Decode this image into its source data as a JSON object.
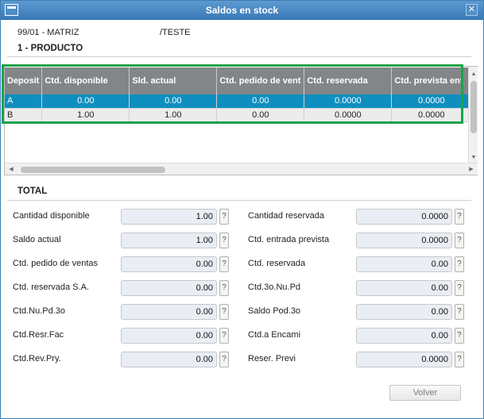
{
  "window": {
    "title": "Saldos en stock"
  },
  "info": {
    "branch": "99/01 - MATRIZ",
    "product_code": "/TESTE"
  },
  "section": {
    "title": "1 - PRODUCTO"
  },
  "grid": {
    "columns": [
      "Deposit",
      "Ctd. disponible",
      "Sld. actual",
      "Ctd. pedido de vent",
      "Ctd. reservada",
      "Ctd. prevista ent"
    ],
    "rows": [
      [
        "A",
        "0.00",
        "0.00",
        "0.00",
        "0.0000",
        "0.0000"
      ],
      [
        "B",
        "1.00",
        "1.00",
        "0.00",
        "0.0000",
        "0.0000"
      ]
    ],
    "selected_row": 0
  },
  "total": {
    "title": "TOTAL",
    "left": [
      {
        "label": "Cantidad disponible",
        "value": "1.00"
      },
      {
        "label": "Saldo actual",
        "value": "1.00"
      },
      {
        "label": "Ctd. pedido de ventas",
        "value": "0.00"
      },
      {
        "label": "Ctd. reservada S.A.",
        "value": "0.00"
      },
      {
        "label": "Ctd.Nu.Pd.3o",
        "value": "0.00"
      },
      {
        "label": "Ctd.Resr.Fac",
        "value": "0.00"
      },
      {
        "label": "Ctd.Rev.Pry.",
        "value": "0.00"
      }
    ],
    "right": [
      {
        "label": "Cantidad reservada",
        "value": "0.0000"
      },
      {
        "label": "Ctd. entrada prevista",
        "value": "0.0000"
      },
      {
        "label": "Ctd. reservada",
        "value": "0.00"
      },
      {
        "label": "Ctd.3o.Nu.Pd",
        "value": "0.00"
      },
      {
        "label": "Saldo Pod.3o",
        "value": "0.00"
      },
      {
        "label": "Ctd.a Encami",
        "value": "0.00"
      },
      {
        "label": "Reser. Previ",
        "value": "0.0000"
      }
    ],
    "help_label": "?"
  },
  "footer": {
    "volver_label": "Volver"
  },
  "icons": {
    "close": "close-icon",
    "scroll_up": "arrow-up-icon",
    "scroll_down": "arrow-down-icon",
    "scroll_left": "arrow-left-icon",
    "scroll_right": "arrow-right-icon"
  },
  "colors": {
    "titlebar": "#3b7ab8",
    "grid_header": "#828689",
    "selected_row": "#0f8fbf",
    "highlight_frame": "#1aa34a"
  }
}
